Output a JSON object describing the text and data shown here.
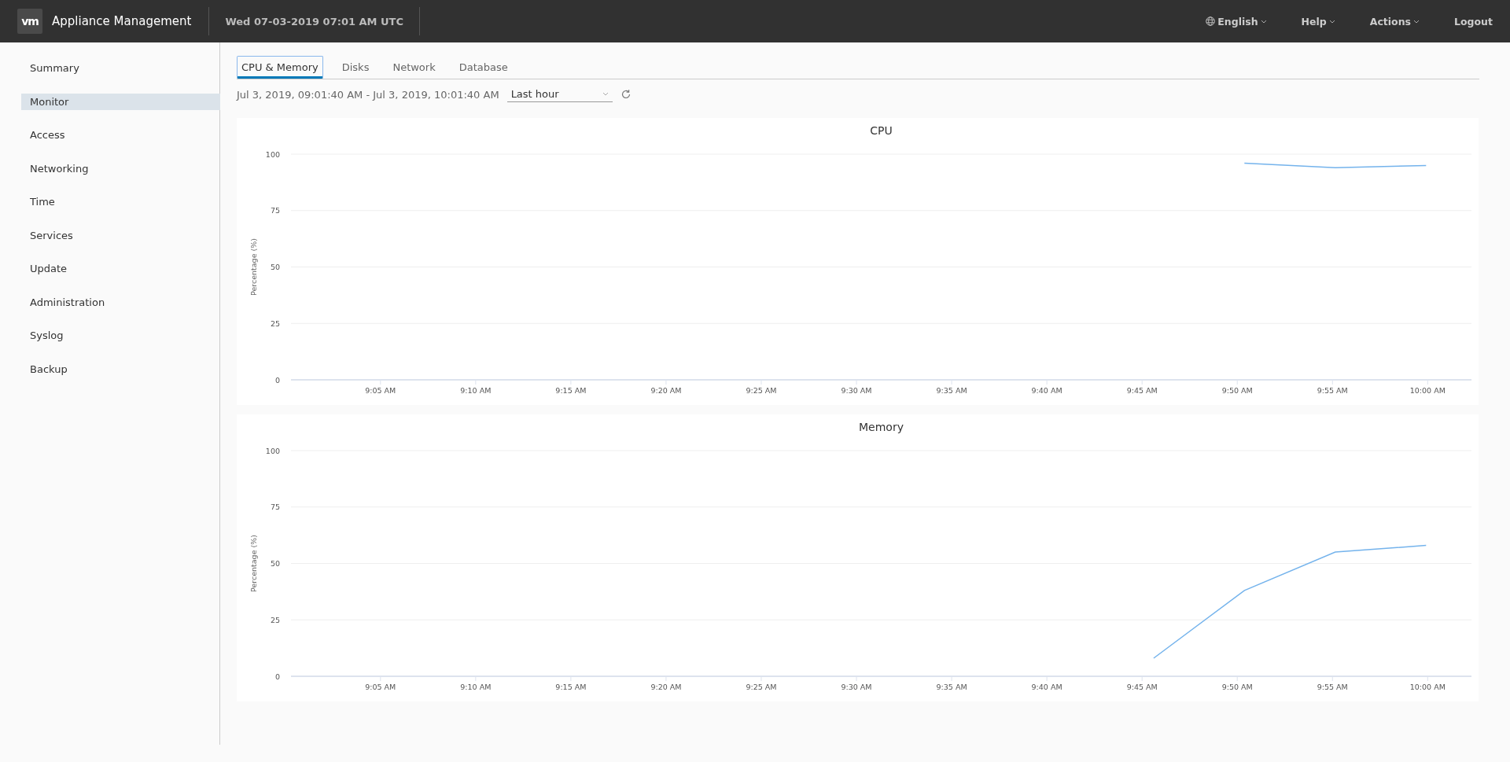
{
  "header": {
    "logo": "vm",
    "title": "Appliance Management",
    "datetime": "Wed 07-03-2019 07:01 AM UTC",
    "menus": [
      {
        "label": "English",
        "kind": "language"
      },
      {
        "label": "Help",
        "kind": "dropdown"
      },
      {
        "label": "Actions",
        "kind": "dropdown"
      },
      {
        "label": "Logout",
        "kind": "link"
      }
    ]
  },
  "sidebar": {
    "items": [
      {
        "label": "Summary",
        "selected": false
      },
      {
        "label": "Monitor",
        "selected": true
      },
      {
        "label": "Access",
        "selected": false
      },
      {
        "label": "Networking",
        "selected": false
      },
      {
        "label": "Time",
        "selected": false
      },
      {
        "label": "Services",
        "selected": false
      },
      {
        "label": "Update",
        "selected": false
      },
      {
        "label": "Administration",
        "selected": false
      },
      {
        "label": "Syslog",
        "selected": false
      },
      {
        "label": "Backup",
        "selected": false
      }
    ]
  },
  "tabs": [
    {
      "label": "CPU & Memory",
      "selected": true
    },
    {
      "label": "Disks",
      "selected": false
    },
    {
      "label": "Network",
      "selected": false
    },
    {
      "label": "Database",
      "selected": false
    }
  ],
  "range": {
    "text": "Jul 3, 2019, 09:01:40 AM - Jul 3, 2019, 10:01:40 AM",
    "value": "Last hour"
  },
  "charts": [
    {
      "time_labels": [
        "9:05 AM",
        "9:10 AM",
        "9:15 AM",
        "9:20 AM",
        "9:25 AM",
        "9:30 AM",
        "9:35 AM",
        "9:40 AM",
        "9:45 AM",
        "9:50 AM",
        "9:55 AM",
        "10:00 AM"
      ],
      "chart_data": {
        "type": "line",
        "title": "CPU",
        "ylabel": "Percentage (%)",
        "categories": [
          null,
          null,
          null,
          null,
          null,
          null,
          null,
          null,
          null,
          null,
          null,
          null,
          null
        ],
        "series": [
          {
            "color": "#74b3ec",
            "values": [
              null,
              null,
              null,
              null,
              null,
              null,
              null,
              null,
              null,
              null,
              96,
              94,
              95
            ]
          }
        ],
        "ylim": [
          0,
          100
        ],
        "yticks": [
          0,
          25,
          50,
          75,
          100
        ],
        "grid": true
      }
    },
    {
      "time_labels": [
        "9:05 AM",
        "9:10 AM",
        "9:15 AM",
        "9:20 AM",
        "9:25 AM",
        "9:30 AM",
        "9:35 AM",
        "9:40 AM",
        "9:45 AM",
        "9:50 AM",
        "9:55 AM",
        "10:00 AM"
      ],
      "chart_data": {
        "type": "line",
        "title": "Memory",
        "ylabel": "Percentage (%)",
        "categories": [
          null,
          null,
          null,
          null,
          null,
          null,
          null,
          null,
          null,
          null,
          null,
          null,
          null
        ],
        "series": [
          {
            "color": "#74b3ec",
            "values": [
              null,
              null,
              null,
              null,
              null,
              null,
              null,
              null,
              null,
              8,
              38,
              55,
              58
            ]
          }
        ],
        "ylim": [
          0,
          100
        ],
        "yticks": [
          0,
          25,
          50,
          75,
          100
        ],
        "grid": true
      }
    }
  ]
}
